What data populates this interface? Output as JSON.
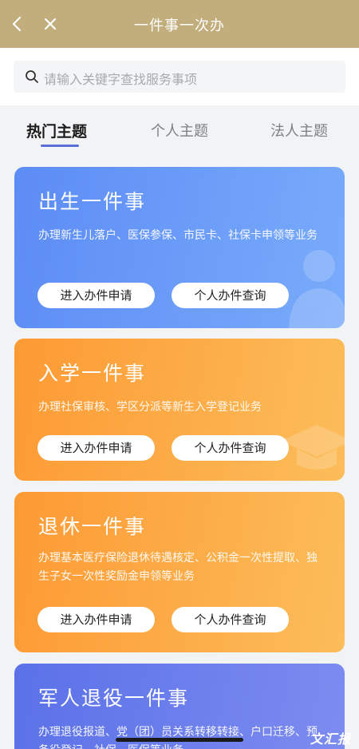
{
  "header": {
    "title": "一件事一次办"
  },
  "search": {
    "placeholder": "请输入关键字查找服务事项"
  },
  "tabs": [
    {
      "label": "热门主题",
      "active": true
    },
    {
      "label": "个人主题",
      "active": false
    },
    {
      "label": "法人主题",
      "active": false
    }
  ],
  "cards": [
    {
      "title": "出生一件事",
      "desc": "办理新生儿落户、医保参保、市民卡、社保卡申领等业务",
      "apply": "进入办件申请",
      "query": "个人办件查询",
      "color": "#5c8cf5"
    },
    {
      "title": "入学一件事",
      "desc": "办理社保审核、学区分派等新生入学登记业务",
      "apply": "进入办件申请",
      "query": "个人办件查询",
      "color": "#fd9a34"
    },
    {
      "title": "退休一件事",
      "desc": "办理基本医疗保险退休待遇核定、公积金一次性提取、独生子女一次性奖励金申领等业务",
      "apply": "进入办件申请",
      "query": "个人办件查询",
      "color": "#fd9a34"
    },
    {
      "title": "军人退役一件事",
      "desc": "办理退役报道、党（团）员关系转移转接、户口迁移、预备役登记、社保、医保等业务",
      "color": "#5b71e8"
    }
  ],
  "watermark": "文汇报"
}
